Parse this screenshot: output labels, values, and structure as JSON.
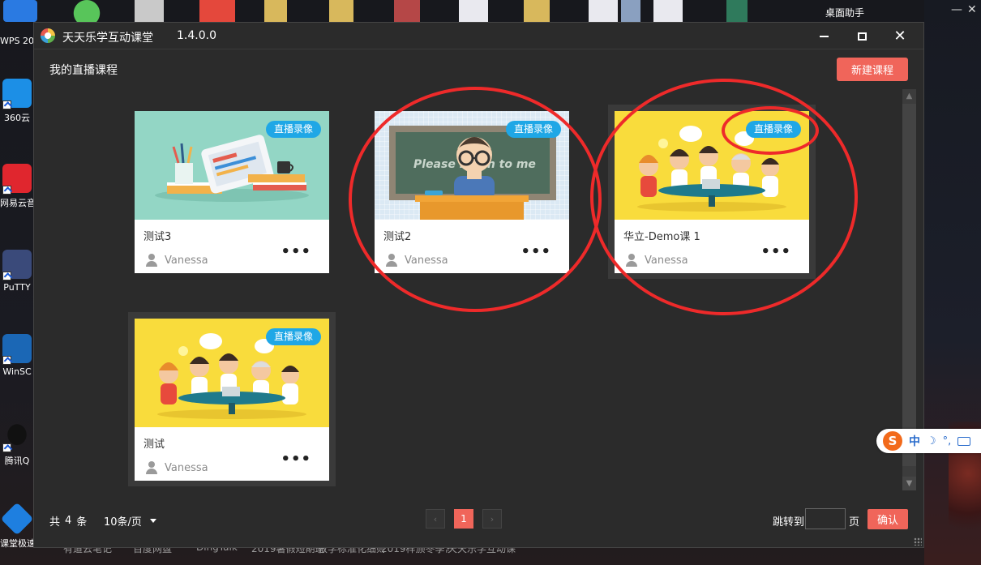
{
  "desktop": {
    "assistant_label": "桌面助手",
    "left_icons": [
      {
        "label": "WPS 20",
        "color": "#2a7ae2"
      },
      {
        "label": "360云",
        "color": "#1c8fe6"
      },
      {
        "label": "网易云音",
        "color": "#e0262e"
      },
      {
        "label": "PuTTY",
        "color": "#3a4a7a"
      },
      {
        "label": "WinSC",
        "color": "#1b67b5"
      },
      {
        "label": "腾讯Q",
        "color": "#111111"
      },
      {
        "label": "课堂极速",
        "color": "#1e7fe0"
      }
    ],
    "taskbar_labels": [
      "有道云笔记",
      "百度网盘",
      "DingTalk",
      "2019暑假短期班学生...",
      "教学标准化细则图片",
      "2019样颁冬季常规班人员",
      "天天乐学互动课堂"
    ]
  },
  "app": {
    "title": "天天乐学互动课堂",
    "version": "1.4.0.0",
    "page_title": "我的直播课程",
    "new_course_label": "新建课程"
  },
  "courses": [
    {
      "title": "测试3",
      "owner": "Vanessa",
      "badge": "直播录像",
      "more": "•••"
    },
    {
      "title": "测试2",
      "owner": "Vanessa",
      "badge": "直播录像",
      "more": "•••"
    },
    {
      "title": "华立-Demo课 1",
      "owner": "Vanessa",
      "badge": "直播录像",
      "more": "•••"
    },
    {
      "title": "测试",
      "owner": "Vanessa",
      "badge": "直播录像",
      "more": "•••"
    }
  ],
  "board_text": "Please listen to me",
  "pagination": {
    "total_prefix": "共",
    "total_count": "4",
    "total_suffix": "条",
    "page_size": "10条/页",
    "current_page": "1",
    "jump_label": "跳转到",
    "jump_unit": "页",
    "jump_value": "",
    "confirm_label": "确认"
  },
  "ime": {
    "logo": "S",
    "mode": "中",
    "moon": "☽",
    "punct": "°,"
  },
  "colors": {
    "accent": "#f0655a",
    "badge": "#1fa7e6",
    "annotation": "#ee2a2a",
    "window_bg": "#2b2b2b"
  }
}
